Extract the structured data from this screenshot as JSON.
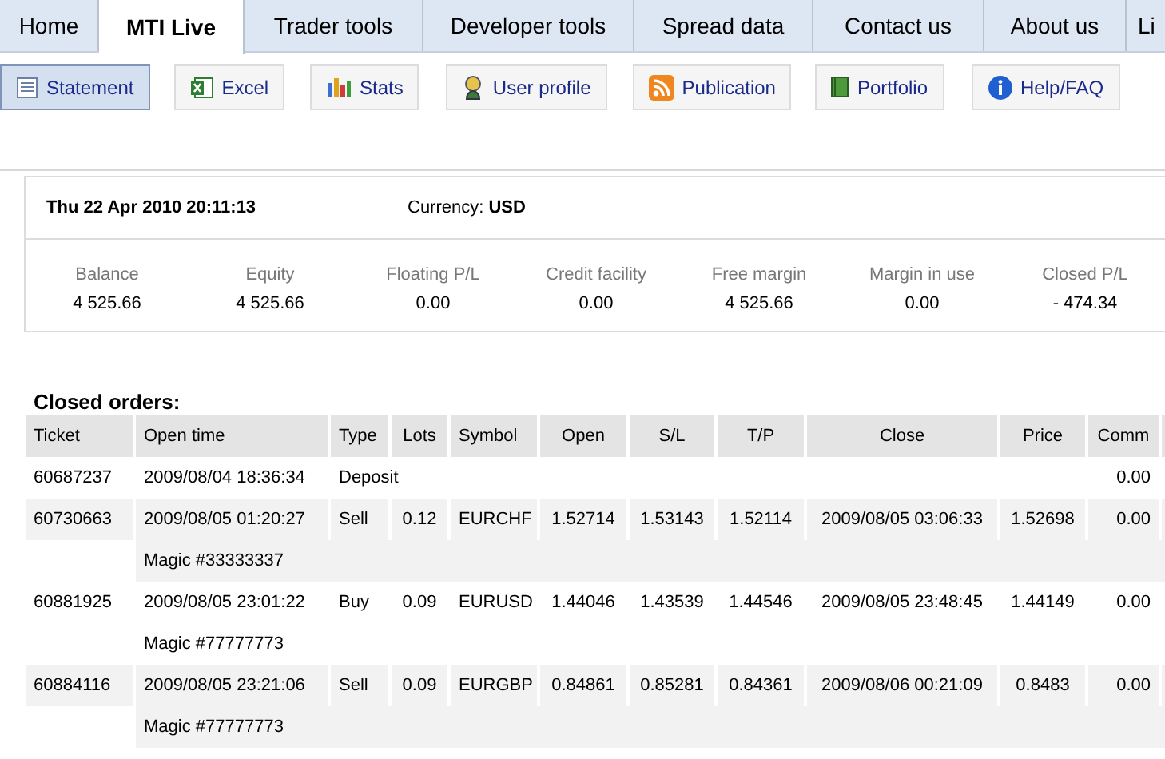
{
  "tabs": [
    {
      "label": "Home",
      "selected": false
    },
    {
      "label": "MTI Live",
      "selected": true
    },
    {
      "label": "Trader tools",
      "selected": false
    },
    {
      "label": "Developer tools",
      "selected": false
    },
    {
      "label": "Spread data",
      "selected": false
    },
    {
      "label": "Contact us",
      "selected": false
    },
    {
      "label": "About us",
      "selected": false
    },
    {
      "label": "Li",
      "selected": false
    }
  ],
  "toolbar": [
    {
      "label": "Statement",
      "kind": "statement",
      "selected": true
    },
    {
      "label": "Excel",
      "kind": "excel",
      "selected": false
    },
    {
      "label": "Stats",
      "kind": "stats",
      "selected": false
    },
    {
      "label": "User profile",
      "kind": "user",
      "selected": false
    },
    {
      "label": "Publication",
      "kind": "rss",
      "selected": false
    },
    {
      "label": "Portfolio",
      "kind": "book",
      "selected": false
    },
    {
      "label": "Help/FAQ",
      "kind": "info",
      "selected": false
    }
  ],
  "summary": {
    "datetime": "Thu 22 Apr 2010 20:11:13",
    "currency_label": "Currency:",
    "currency": "USD",
    "stats": [
      {
        "label": "Balance",
        "value": "4 525.66"
      },
      {
        "label": "Equity",
        "value": "4 525.66"
      },
      {
        "label": "Floating P/L",
        "value": "0.00"
      },
      {
        "label": "Credit facility",
        "value": "0.00"
      },
      {
        "label": "Free margin",
        "value": "4 525.66"
      },
      {
        "label": "Margin in use",
        "value": "0.00"
      },
      {
        "label": "Closed P/L",
        "value": "- 474.34"
      }
    ]
  },
  "closed_orders": {
    "title": "Closed orders:",
    "columns": [
      "Ticket",
      "Open time",
      "Type",
      "Lots",
      "Symbol",
      "Open",
      "S/L",
      "T/P",
      "Close",
      "Price",
      "Comm"
    ],
    "rows": [
      {
        "cells": [
          "60687237",
          "2009/08/04 18:36:34",
          "Deposit",
          "",
          "",
          "",
          "",
          "",
          "",
          "",
          "0.00"
        ]
      },
      {
        "cells": [
          "60730663",
          "2009/08/05 01:20:27",
          "Sell",
          "0.12",
          "EURCHF",
          "1.52714",
          "1.53143",
          "1.52114",
          "2009/08/05 03:06:33",
          "1.52698",
          "0.00"
        ],
        "magic": "Magic #33333337"
      },
      {
        "cells": [
          "60881925",
          "2009/08/05 23:01:22",
          "Buy",
          "0.09",
          "EURUSD",
          "1.44046",
          "1.43539",
          "1.44546",
          "2009/08/05 23:48:45",
          "1.44149",
          "0.00"
        ],
        "magic": "Magic #77777773"
      },
      {
        "cells": [
          "60884116",
          "2009/08/05 23:21:06",
          "Sell",
          "0.09",
          "EURGBP",
          "0.84861",
          "0.85281",
          "0.84361",
          "2009/08/06 00:21:09",
          "0.8483",
          "0.00"
        ],
        "magic": "Magic #77777773"
      }
    ]
  }
}
